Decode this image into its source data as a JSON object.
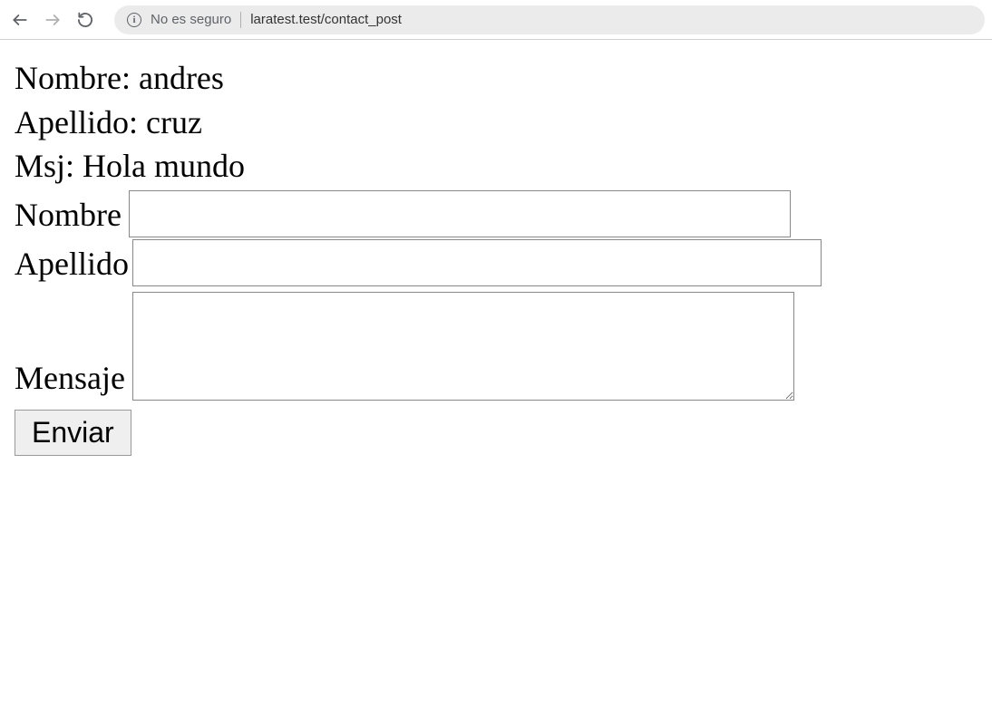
{
  "browser": {
    "security_text": "No es seguro",
    "url": "laratest.test/contact_post"
  },
  "output": {
    "nombre_label": "Nombre:",
    "nombre_value": "andres",
    "apellido_label": "Apellido:",
    "apellido_value": "cruz",
    "msj_label": "Msj:",
    "msj_value": "Hola mundo"
  },
  "form": {
    "nombre_label": "Nombre",
    "nombre_value": "",
    "apellido_label": "Apellido",
    "apellido_value": "",
    "mensaje_label": "Mensaje",
    "mensaje_value": "",
    "submit_label": "Enviar"
  }
}
